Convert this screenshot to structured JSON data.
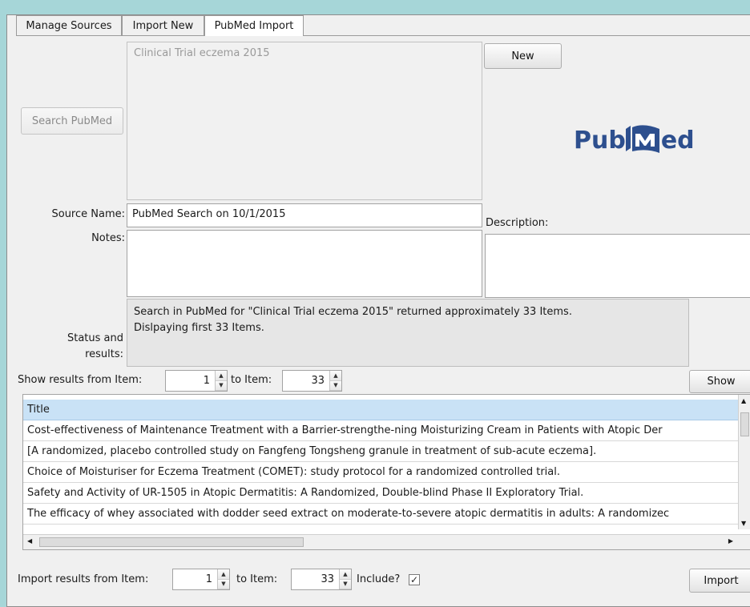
{
  "tabs": [
    {
      "label": "Manage Sources"
    },
    {
      "label": "Import New"
    },
    {
      "label": "PubMed Import"
    }
  ],
  "search": {
    "button_label": "Search PubMed",
    "query": "Clinical Trial eczema 2015",
    "new_label": "New"
  },
  "logo": {
    "left_text": "Pub",
    "right_text": "ed",
    "accent": "#2d4f8e",
    "icon": "pubmed-book-m-icon"
  },
  "form": {
    "source_name_label": "Source Name:",
    "source_name_value": "PubMed Search on 10/1/2015",
    "description_label": "Description:",
    "notes_label": "Notes:",
    "status_label_1": "Status and",
    "status_label_2": "results:",
    "status_line_1": "Search in PubMed for \"Clinical Trial eczema 2015\" returned approximately 33 Items.",
    "status_line_2": "Dislpaying first 33 Items."
  },
  "show_range": {
    "from_label": "Show results from Item:",
    "from_value": "1",
    "to_label": "to Item:",
    "to_value": "33",
    "button_label": "Show"
  },
  "results": {
    "header": "Title",
    "rows": [
      "Cost-effectiveness of Maintenance Treatment with a Barrier-strengthe-ning Moisturizing Cream in Patients with Atopic Der",
      "[A randomized, placebo controlled study on Fangfeng Tongsheng granule in treatment of sub-acute eczema].",
      "Choice of Moisturiser for Eczema Treatment (COMET): study protocol for a randomized controlled trial.",
      "Safety and Activity of UR-1505 in Atopic Dermatitis: A Randomized, Double-blind Phase II Exploratory Trial.",
      "The efficacy of whey associated with dodder seed extract on moderate-to-severe atopic dermatitis in adults: A randomizec"
    ]
  },
  "import_range": {
    "from_label": "Import results from Item:",
    "from_value": "1",
    "to_label": "to Item:",
    "to_value": "33",
    "include_label": "Include?",
    "include_checked": "✓",
    "button_label": "Import"
  }
}
